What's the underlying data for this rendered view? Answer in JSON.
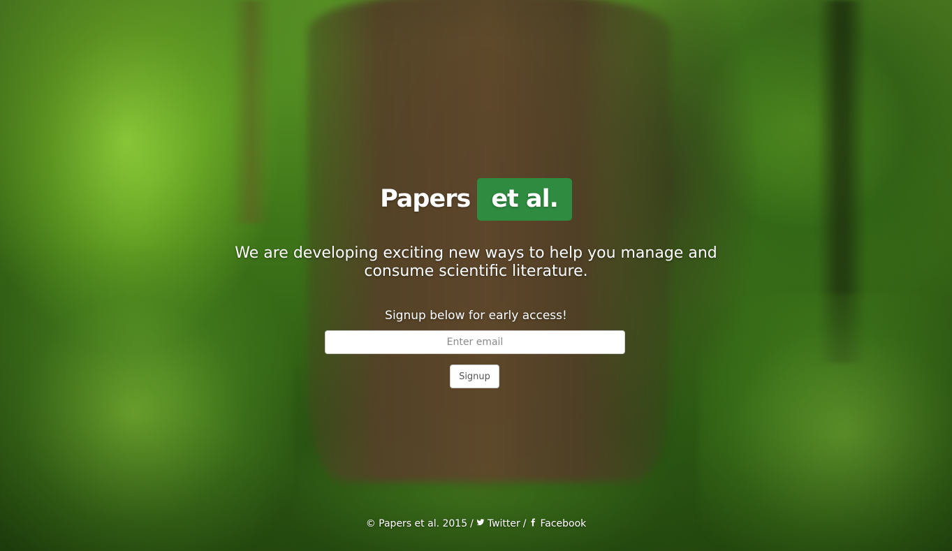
{
  "logo": {
    "word": "Papers",
    "badge": "et al.",
    "badge_color": "#2e8b40"
  },
  "tagline": "We are developing exciting new ways to help you manage and consume scientific literature.",
  "signup": {
    "label": "Signup below for early access!",
    "email_placeholder": "Enter email",
    "email_value": "",
    "button_label": "Signup"
  },
  "footer": {
    "copyright": "© Papers et al. 2015",
    "separator": "/",
    "twitter": {
      "icon": "twitter-icon",
      "label": "Twitter"
    },
    "facebook": {
      "icon": "facebook-icon",
      "label": "Facebook"
    }
  }
}
